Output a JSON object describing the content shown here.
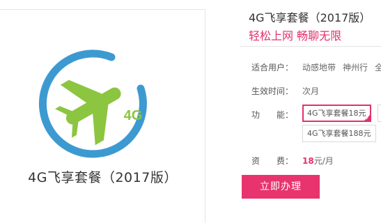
{
  "product": {
    "name": "4G飞享套餐（2017版）",
    "logo_badge": "4G"
  },
  "info": {
    "title": "4G飞享套餐（2017版）",
    "slogan": "轻松上网 畅聊无限"
  },
  "details": {
    "users_label": "适合用户：",
    "users": [
      "动感地带",
      "神州行",
      "全球通"
    ],
    "effective_label": "生效时间：",
    "effective_value": "次月",
    "function_label": "功　　能：",
    "options": [
      {
        "label": "4G飞享套餐18元",
        "selected": true
      },
      {
        "label": "4G飞享套餐188元",
        "selected": false
      }
    ],
    "fee_label": "资　　费：",
    "fee_amount": "18",
    "fee_unit": "元/月"
  },
  "actions": {
    "apply_label": "立即办理"
  },
  "colors": {
    "accent": "#e3306b",
    "logo_ring": "#3d9ad1",
    "logo_plane": "#8cc540"
  }
}
